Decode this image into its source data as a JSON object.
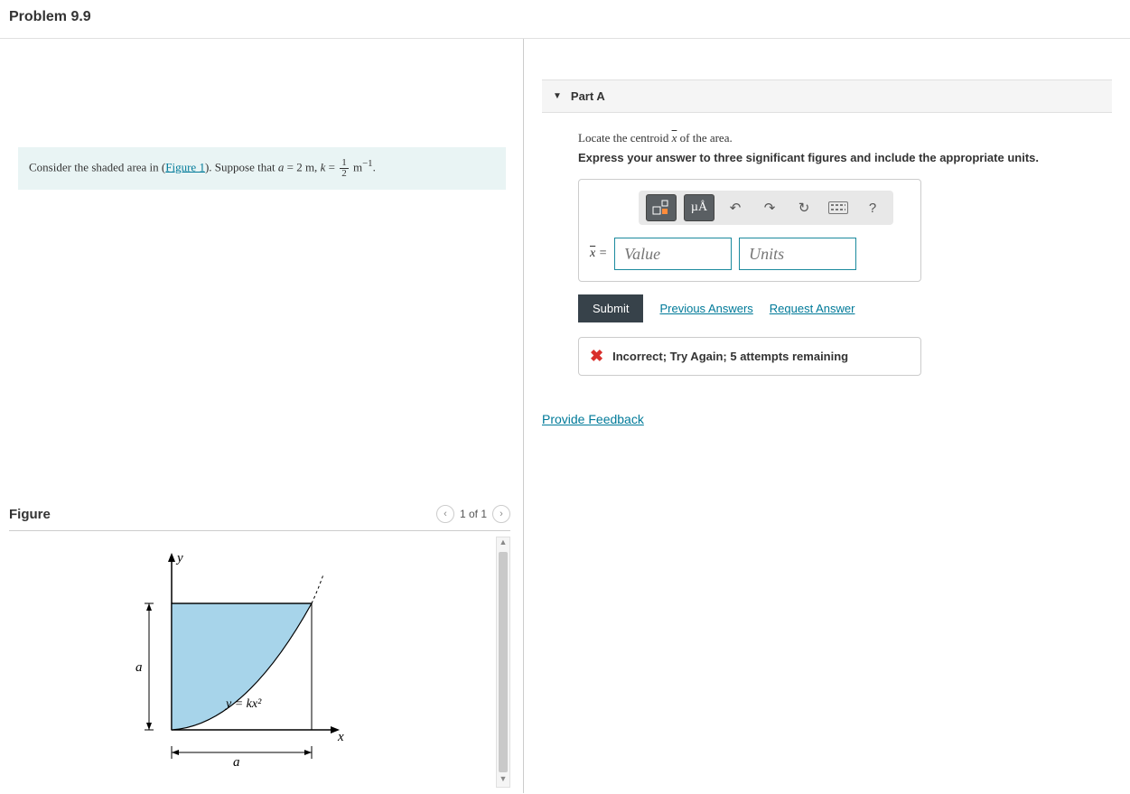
{
  "title": "Problem 9.9",
  "intro": {
    "prefix": "Consider the shaded area in (",
    "figure_link": "Figure 1",
    "suffix_before_vars": "). Suppose that ",
    "a_var": "a",
    "a_val": " = 2 m, ",
    "k_var": "k",
    "eq": " = ",
    "frac_num": "1",
    "frac_den": "2",
    "unit_tail": " m",
    "exp": "−1",
    "period": "."
  },
  "figure": {
    "label": "Figure",
    "pager": "1 of 1",
    "y_label": "y",
    "x_label": "x",
    "a_vert": "a",
    "a_horiz": "a",
    "curve_label": "y = kx²"
  },
  "part": {
    "label": "Part A",
    "instr1_pre": "Locate the centroid ",
    "xbar": "x̄",
    "instr1_post": " of the area.",
    "instr2": "Express your answer to three significant figures and include the appropriate units.",
    "toolbar": {
      "templates": "templates",
      "mu": "µÅ",
      "undo": "↶",
      "redo": "↷",
      "reset": "↻",
      "keyboard": "keyboard",
      "help": "?"
    },
    "answer_label_pre": "x̄",
    "answer_label_eq": " = ",
    "value_placeholder": "Value",
    "units_placeholder": "Units",
    "submit": "Submit",
    "prev_answers": "Previous Answers",
    "request_answer": "Request Answer",
    "feedback": "Incorrect; Try Again; 5 attempts remaining"
  },
  "provide_feedback": "Provide Feedback"
}
